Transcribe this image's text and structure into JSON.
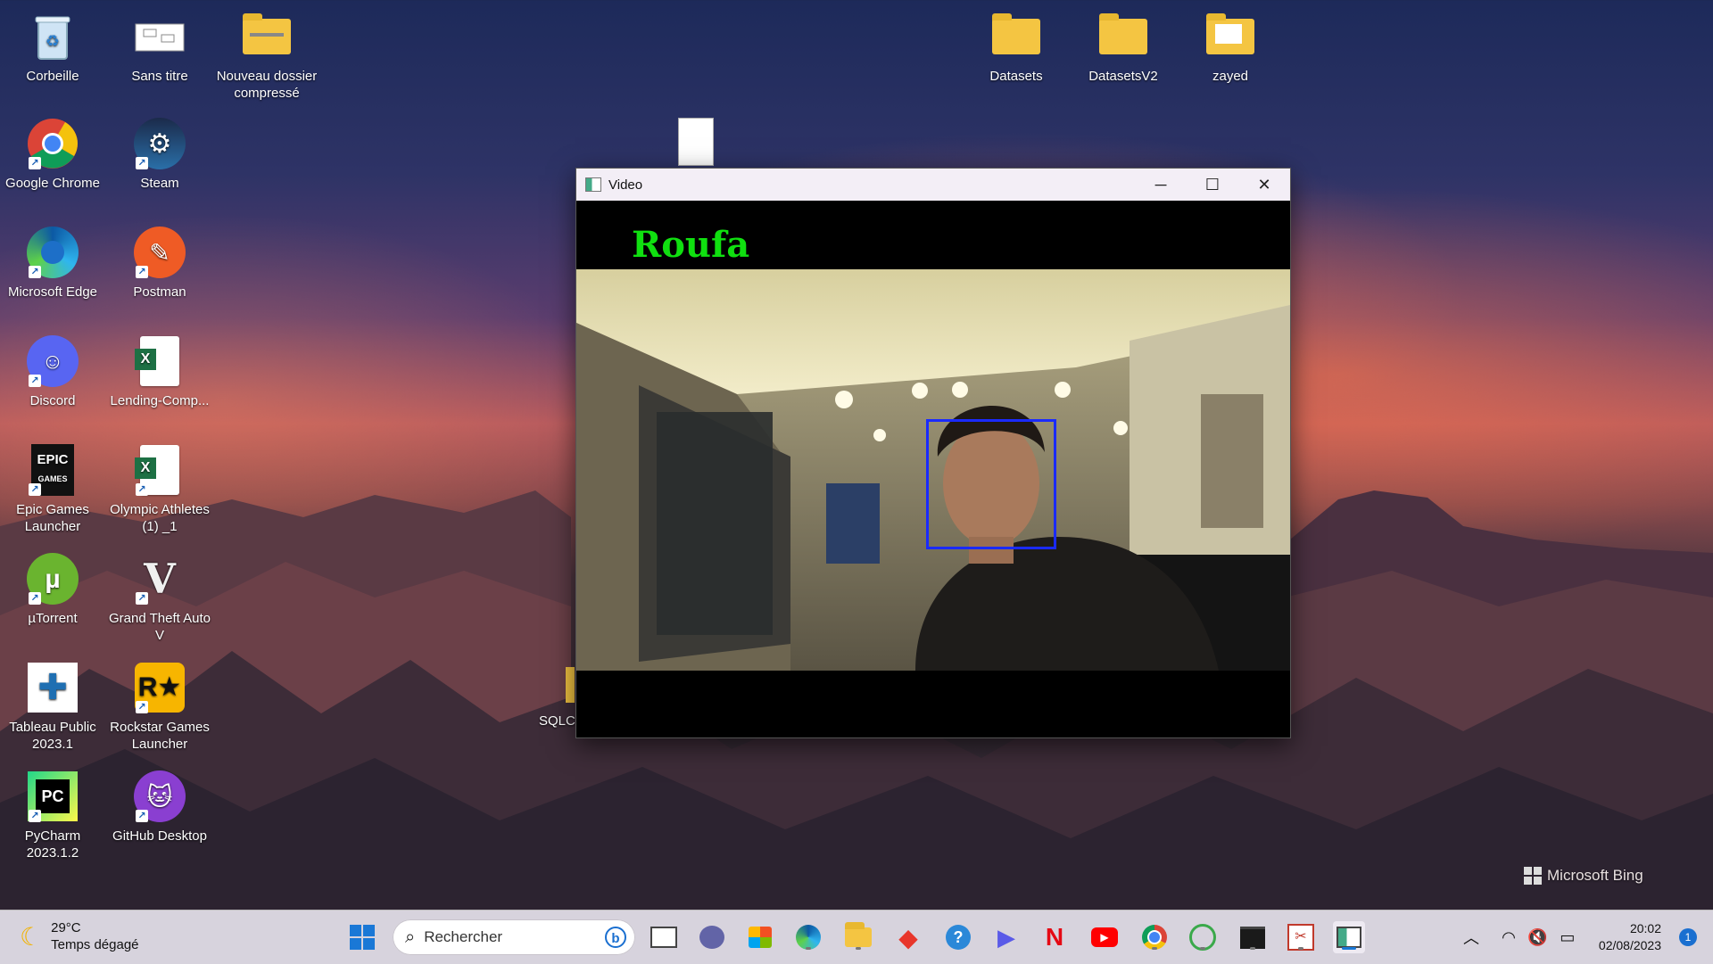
{
  "desktop": {
    "left_icons": [
      {
        "label": "Corbeille",
        "icon": "recycle-bin-icon"
      },
      {
        "label": "Sans titre",
        "icon": "image-file-icon"
      },
      {
        "label": "Nouveau dossier compressé",
        "icon": "zip-folder-icon"
      },
      {
        "label": "Google Chrome",
        "icon": "chrome-icon"
      },
      {
        "label": "Steam",
        "icon": "steam-icon"
      },
      {
        "label": "Microsoft Edge",
        "icon": "edge-icon"
      },
      {
        "label": "Postman",
        "icon": "postman-icon"
      },
      {
        "label": "Discord",
        "icon": "discord-icon"
      },
      {
        "label": "Lending-Comp...",
        "icon": "excel-file-icon"
      },
      {
        "label": "Epic Games Launcher",
        "icon": "epic-games-icon"
      },
      {
        "label": "Olympic Athletes (1) _1",
        "icon": "excel-file-icon"
      },
      {
        "label": "µTorrent",
        "icon": "utorrent-icon"
      },
      {
        "label": "Grand Theft Auto V",
        "icon": "gta-icon"
      },
      {
        "label": "Tableau Public 2023.1",
        "icon": "tableau-icon"
      },
      {
        "label": "Rockstar Games Launcher",
        "icon": "rockstar-icon"
      },
      {
        "label": "PyCharm 2023.1.2",
        "icon": "pycharm-icon"
      },
      {
        "label": "GitHub Desktop",
        "icon": "github-icon"
      }
    ],
    "right_icons": [
      {
        "label": "Datasets",
        "icon": "folder-icon"
      },
      {
        "label": "DatasetsV2",
        "icon": "folder-icon"
      },
      {
        "label": "zayed",
        "icon": "folder-icon"
      }
    ],
    "partial_icon_label": "SQLC",
    "watermark": "Microsoft Bing"
  },
  "window": {
    "title": "Video",
    "overlay_name": "Roufa",
    "minimize": "─",
    "maximize": "☐",
    "close": "✕"
  },
  "taskbar": {
    "weather_temp": "29°C",
    "weather_desc": "Temps dégagé",
    "search_placeholder": "Rechercher",
    "time": "20:02",
    "date": "02/08/2023",
    "notification_count": "1"
  }
}
